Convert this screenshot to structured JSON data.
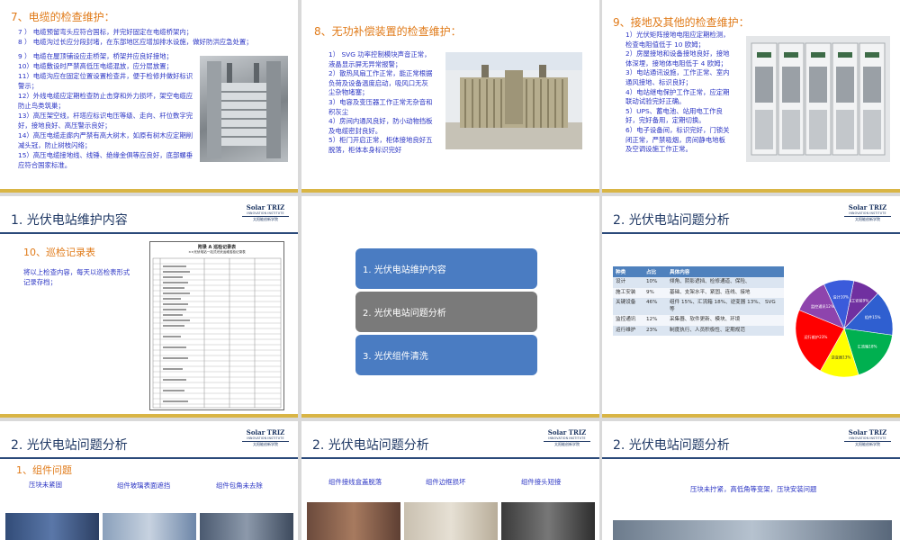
{
  "slide1": {
    "title": "7、电缆的检查维护：",
    "lines_top": [
      "7 ） 电缆预留弯头应符合国标，并完好固定在电缆桥架内；",
      "8 ） 电缆沟过长应分段封堵，在东部地区应增加排水设施，做好防洪应急处置；"
    ],
    "lines_left": [
      "9 ） 电缆在屋顶铺设应走桥架，桥架并应良好接地；",
      "10）电缆敷设时严禁高低压电缆混放，应分层放置；",
      "11）电缆沟应在固定位置设置检查井，便于检修并做好标识警示；",
      "12）外线电缆应定期检查防止击穿和外力损坏，架空电缆应防止鸟类筑巢；",
      "13）高压架空线，杆塔应标识电压等级、走向、杆位数字完好，接地良好、高压警示良好；",
      "14）高压电缆走廊内严禁有高大树木，如原有树木应定期削减头冠，防止树枝闪络；",
      "15）高压电缆接地线、线锤、绝缘金俱等应良好，底部螺垂应符合国家标准。"
    ],
    "photo_icon": "cable-tray-photo"
  },
  "slide2": {
    "title": "8、无功补偿装置的检查维护：",
    "lines": [
      "1） SVG 功率控制模块声音正常，液晶显示屏无异常报警；",
      "2）散热风扇工作正常，能正常根据负荷及设备温度启动，吸风口无灰尘杂物堵塞；",
      "3）电容及变压器工作正常无杂音和积灰尘",
      "4）房间内通风良好，防小动物挡板及电缆密封良好。",
      "5）柜门开启正常，柜体接地良好五脱落，柜体本身标识完好"
    ],
    "photo_icon": "transformer-photo"
  },
  "slide3": {
    "title": "9、接地及其他的检查维护：",
    "lines": [
      "1）光伏矩阵接地电阻应定期检测，检查电阻值低于 10 欧姆；",
      "2）房屋接地和设备接地良好，接地体深埋，接地体电阻低于 4 欧姆；",
      "3）电站通讯设施，工作正常、室内通风接地、标识良好；",
      "4）电站继电保护工作正常，应定期联动试验完好正确。",
      "5）UPS、蓄电池、站用电工作良好，完好备用，定期切换。",
      "6）电子设备间，标识完好，门锁关闭正常，严禁吸烟，房间静电地板及空调设施工作正常。"
    ],
    "photo_icon": "cabinet-photo"
  },
  "slide4": {
    "header": "1. 光伏电站维护内容",
    "subtitle": "10、巡检记录表",
    "text": "将以上检查内容，每天以巡检表形式记录存档；",
    "table_title": "附录 A 巡检记录表",
    "table_sub": "××光伏电站一站式光伏运维巡检记录表"
  },
  "slide5": {
    "items": [
      "1. 光伏电站维护内容",
      "2. 光伏电站问题分析",
      "3. 光伏组件清洗"
    ]
  },
  "slide6": {
    "header": "2. 光伏电站问题分析",
    "table_headers": [
      "种类",
      "占比",
      "具体内容"
    ],
    "rows": [
      {
        "kind": "设计",
        "ratio": "10%",
        "detail": "倾角、阴影遮挡、检修通道、保险、"
      },
      {
        "kind": "施工安装",
        "ratio": "9%",
        "detail": "基础、支架水平、紧固、连线、接地"
      },
      {
        "kind": "关键设备",
        "ratio": "46%",
        "detail": "组件 15%、汇流箱 18%、逆变器 13%、 SVG 等"
      },
      {
        "kind": "监控通讯",
        "ratio": "12%",
        "detail": "采集器、软件更新、模块、环境"
      },
      {
        "kind": "运行维护",
        "ratio": "23%",
        "detail": "制度执行、人员积极性、定期规范"
      }
    ],
    "chart_data": {
      "type": "pie",
      "slices": [
        {
          "label": "施工安装9%",
          "value": 9,
          "color": "#7030a0"
        },
        {
          "label": "组件15%",
          "value": 15,
          "color": "#2f5fd0"
        },
        {
          "label": "汇流箱18%",
          "value": 18,
          "color": "#00b050"
        },
        {
          "label": "逆变器13%",
          "value": 13,
          "color": "#ffff00"
        },
        {
          "label": "运行维护23%",
          "value": 23,
          "color": "#ff0000"
        },
        {
          "label": "监控通讯12%",
          "value": 12,
          "color": "#8e44ad"
        },
        {
          "label": "设计10%",
          "value": 10,
          "color": "#3b5bdb"
        }
      ]
    }
  },
  "slide7": {
    "header": "2. 光伏电站问题分析",
    "subtitle": "1、组件问题",
    "labels": [
      "压块未紧固",
      "组件玻璃表面遮挡",
      "组件包角未去除"
    ]
  },
  "slide8": {
    "header": "2. 光伏电站问题分析",
    "labels": [
      "组件接线盒盖脱落",
      "组件边框损坏",
      "组件接头短接"
    ]
  },
  "slide9": {
    "header": "2. 光伏电站问题分析",
    "label": "压块未拧紧，高低角等变架，压块安装问题"
  },
  "logo": {
    "line1": "Solar TRIZ",
    "line2": "INNOVATION INSTITUTE",
    "line3": "太阳能创新学院"
  }
}
